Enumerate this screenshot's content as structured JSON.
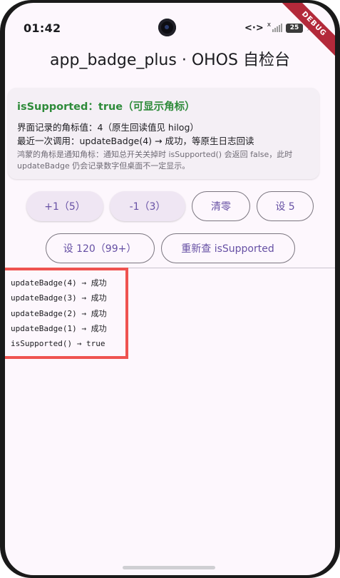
{
  "status_bar": {
    "time": "01:42",
    "data_indicator": "<·>",
    "signal_x": "x",
    "battery": "25",
    "charging": "⚡"
  },
  "debug_banner": "DEBUG",
  "app_title": "app_badge_plus · OHOS 自检台",
  "card": {
    "title": "isSupported：true（可显示角标）",
    "badge_value_line": "界面记录的角标值：4（原生回读值见 hilog）",
    "last_call_line": "最近一次调用：updateBadge(4) → 成功，等原生日志回读",
    "note": "鸿蒙的角标是通知角标：通知总开关关掉时 isSupported() 会返回 false，此时 updateBadge 仍会记录数字但桌面不一定显示。"
  },
  "buttons": {
    "plus_one": "+1（5）",
    "minus_one": "-1（3）",
    "clear": "清零",
    "set_five": "设 5",
    "set_120": "设 120（99+）",
    "recheck": "重新查 isSupported"
  },
  "log": [
    "updateBadge(4) → 成功",
    "updateBadge(3) → 成功",
    "updateBadge(2) → 成功",
    "updateBadge(1) → 成功",
    "isSupported() → true"
  ],
  "colors": {
    "success": "#2e8b3a",
    "accent": "#6650a4",
    "highlight_border": "#ef5350"
  }
}
